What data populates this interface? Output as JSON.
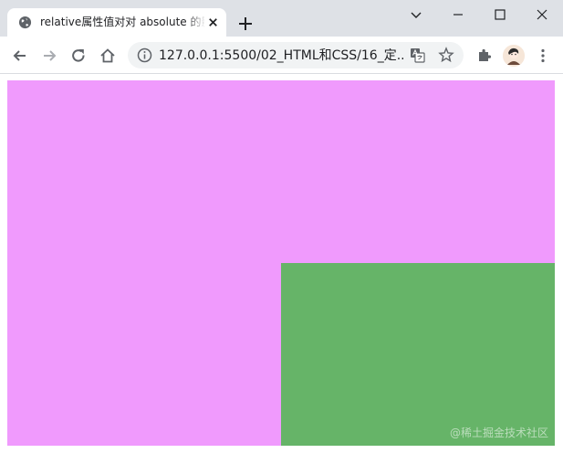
{
  "tab": {
    "title": "relative属性值对对 absolute 的影响"
  },
  "toolbar": {
    "url": "127.0.0.1:5500/02_HTML和CSS/16_定..."
  },
  "content": {
    "pink_color": "#f09afd",
    "green_color": "#66b468"
  },
  "watermark": "@稀土掘金技术社区"
}
